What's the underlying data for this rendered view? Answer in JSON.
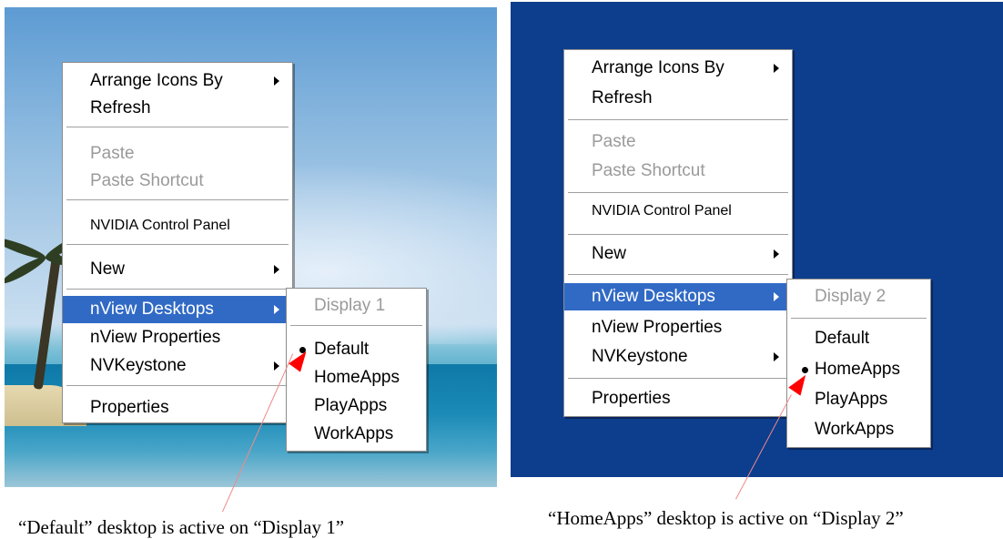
{
  "menu": {
    "items": [
      "Arrange Icons By",
      "Refresh",
      "Paste",
      "Paste Shortcut",
      "NVIDIA Control Panel",
      "New",
      "nView Desktops",
      "nView Properties",
      "NVKeystone",
      "Properties"
    ]
  },
  "panel1": {
    "submenu_header": "Display 1",
    "submenu_items": [
      "Default",
      "HomeApps",
      "PlayApps",
      "WorkApps"
    ],
    "active_item": "Default",
    "caption": "“Default” desktop is active on “Display 1”"
  },
  "panel2": {
    "submenu_header": "Display 2",
    "submenu_items": [
      "Default",
      "HomeApps",
      "PlayApps",
      "WorkApps"
    ],
    "active_item": "HomeApps",
    "caption": "“HomeApps” desktop is active on “Display 2”"
  },
  "colors": {
    "highlight": "#316ac5",
    "desktop_blue": "#0d3d8d",
    "pointer": "#ff0000",
    "disabled_text": "#9a9a9a"
  }
}
